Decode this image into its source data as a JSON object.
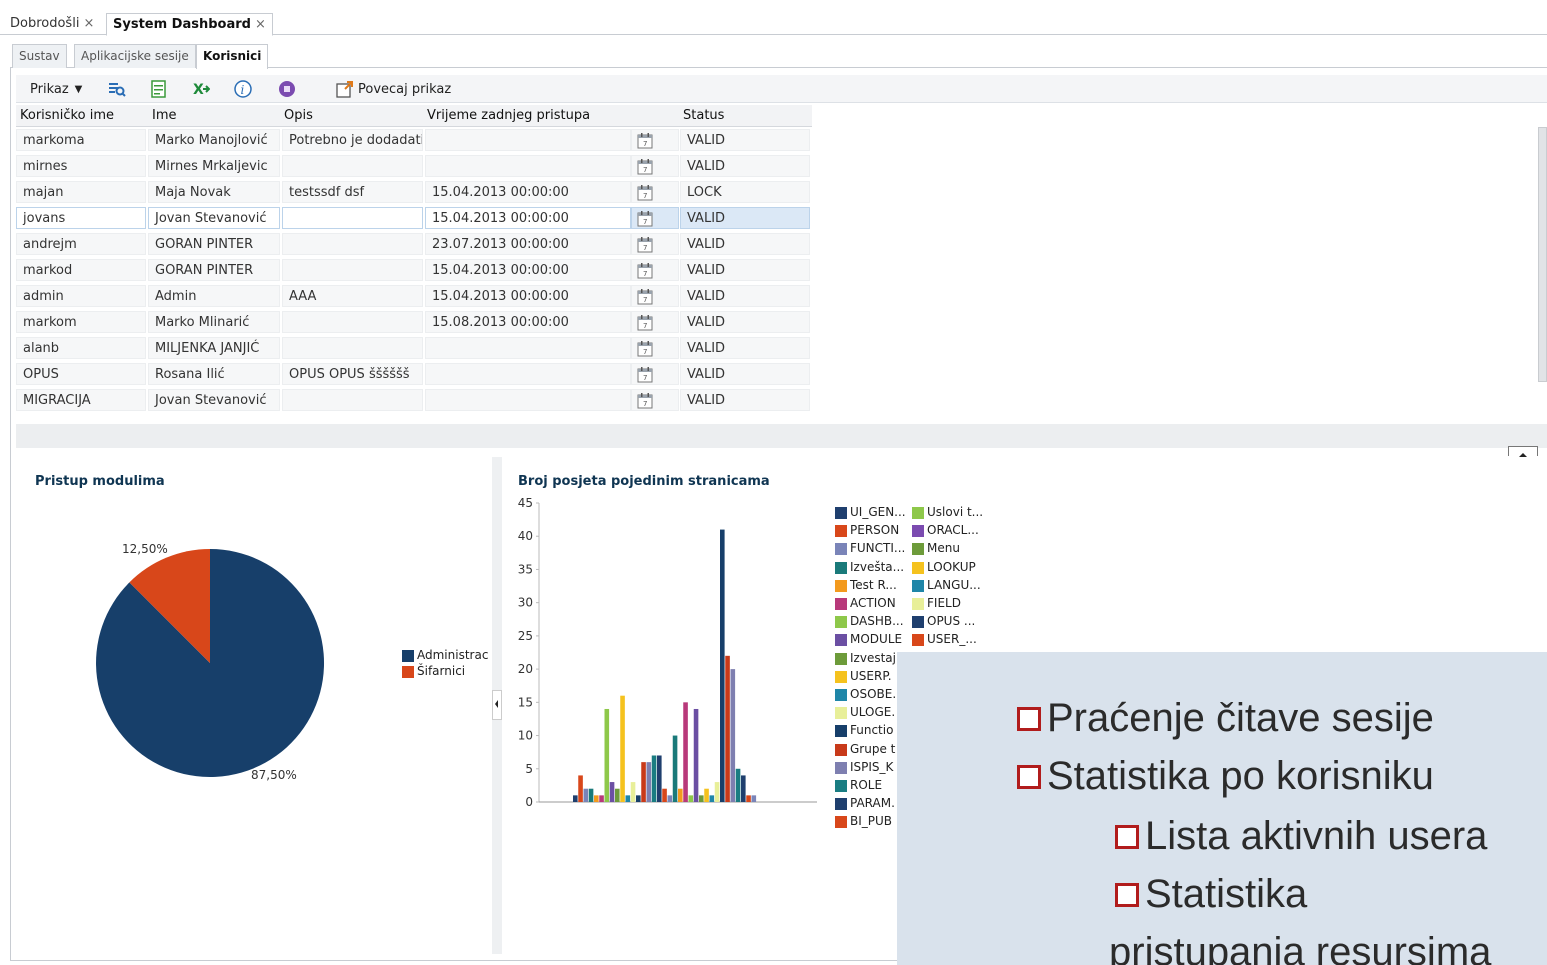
{
  "top_tabs": [
    {
      "label": "Dobrodošli"
    },
    {
      "label": "System Dashboard"
    }
  ],
  "sub_tabs": [
    {
      "label": "Sustav"
    },
    {
      "label": "Aplikacijske sesije"
    },
    {
      "label": "Korisnici"
    }
  ],
  "toolbar": {
    "view_label": "Prikaz",
    "enlarge_label": "Povecaj prikaz"
  },
  "table": {
    "columns": [
      "Korisničko ime",
      "Ime",
      "Opis",
      "Vrijeme zadnjeg pristupa",
      "Status"
    ],
    "rows": [
      [
        "markoma",
        "Marko Manojlović",
        "Potrebno je dodadati",
        "",
        "VALID"
      ],
      [
        "mirnes",
        "Mirnes Mrkaljevic",
        "",
        "",
        "VALID"
      ],
      [
        "majan",
        "Maja Novak",
        "testssdf dsf",
        "15.04.2013 00:00:00",
        "LOCK"
      ],
      [
        "jovans",
        "Jovan Stevanović",
        "",
        "15.04.2013 00:00:00",
        "VALID"
      ],
      [
        "andrejm",
        "GORAN PINTER",
        "",
        "23.07.2013 00:00:00",
        "VALID"
      ],
      [
        "markod",
        "GORAN PINTER",
        "",
        "15.04.2013 00:00:00",
        "VALID"
      ],
      [
        "admin",
        "Admin",
        "AAA",
        "15.04.2013 00:00:00",
        "VALID"
      ],
      [
        "markom",
        "Marko Mlinarić",
        "",
        "15.08.2013 00:00:00",
        "VALID"
      ],
      [
        "alanb",
        "MILJENKA JANJIĆ",
        "",
        "",
        "VALID"
      ],
      [
        "OPUS",
        "Rosana Ilić",
        "OPUS OPUS šššššš",
        "",
        "VALID"
      ],
      [
        "MIGRACIJA",
        "Jovan Stevanović",
        "",
        "",
        "VALID"
      ]
    ]
  },
  "pie_panel": {
    "title": "Pristup modulima",
    "label_small": "12,50%",
    "label_large": "87,50%",
    "legend": [
      "Administrac",
      "Šifarnici"
    ]
  },
  "bar_panel": {
    "title": "Broj posjeta pojedinim stranicama",
    "legend_col1": [
      "UI_GEN...",
      "PERSON",
      "FUNCTI...",
      "Izvešta...",
      "Test R...",
      "ACTION",
      "DASHB...",
      "MODULE",
      "Izvestaj",
      "USERP.",
      "OSOBE.",
      "ULOGE.",
      "Functio",
      "Grupe t",
      "ISPIS_K",
      "ROLE",
      "PARAM.",
      "BI_PUB"
    ],
    "legend_col2": [
      "Uslovi t...",
      "ORACL...",
      "Menu",
      "LOOKUP",
      "LANGU...",
      "FIELD",
      "OPUS ...",
      "USER_..."
    ]
  },
  "chart_data": [
    {
      "type": "pie",
      "title": "Pristup modulima",
      "labels": [
        "Administrac",
        "Šifarnici"
      ],
      "values": [
        87.5,
        12.5
      ],
      "colors": [
        "#173f6a",
        "#d8471a"
      ],
      "legend": "right"
    },
    {
      "type": "bar",
      "title": "Broj posjeta pojedinim stranicama",
      "ylim": [
        0,
        45
      ],
      "yticks": [
        0,
        5,
        10,
        15,
        20,
        25,
        30,
        35,
        40,
        45
      ],
      "values": [
        1,
        4,
        2,
        2,
        1,
        1,
        14,
        3,
        2,
        16,
        1,
        3,
        1,
        6,
        6,
        7,
        7,
        2,
        1,
        10,
        2,
        15,
        1,
        14,
        1,
        2,
        1,
        3,
        41,
        22,
        20,
        5,
        4,
        1,
        1
      ],
      "colors": [
        "#1f3f6e",
        "#d8471a",
        "#7a84b8",
        "#1a7a7a",
        "#f39a1e",
        "#b8397a",
        "#8ec84a",
        "#6b4fa3",
        "#6d9b3a",
        "#f5c21e",
        "#1f86a8",
        "#e8ef99",
        "#173f6a",
        "#c83a1a",
        "#7e7fb0",
        "#1a7d82"
      ],
      "grid": false
    }
  ],
  "overlay": {
    "lines": [
      "Praćenje čitave sesije",
      "Statistika po korisniku",
      "Lista aktivnih usera",
      "Statistika",
      "pristupanja resursima"
    ]
  }
}
